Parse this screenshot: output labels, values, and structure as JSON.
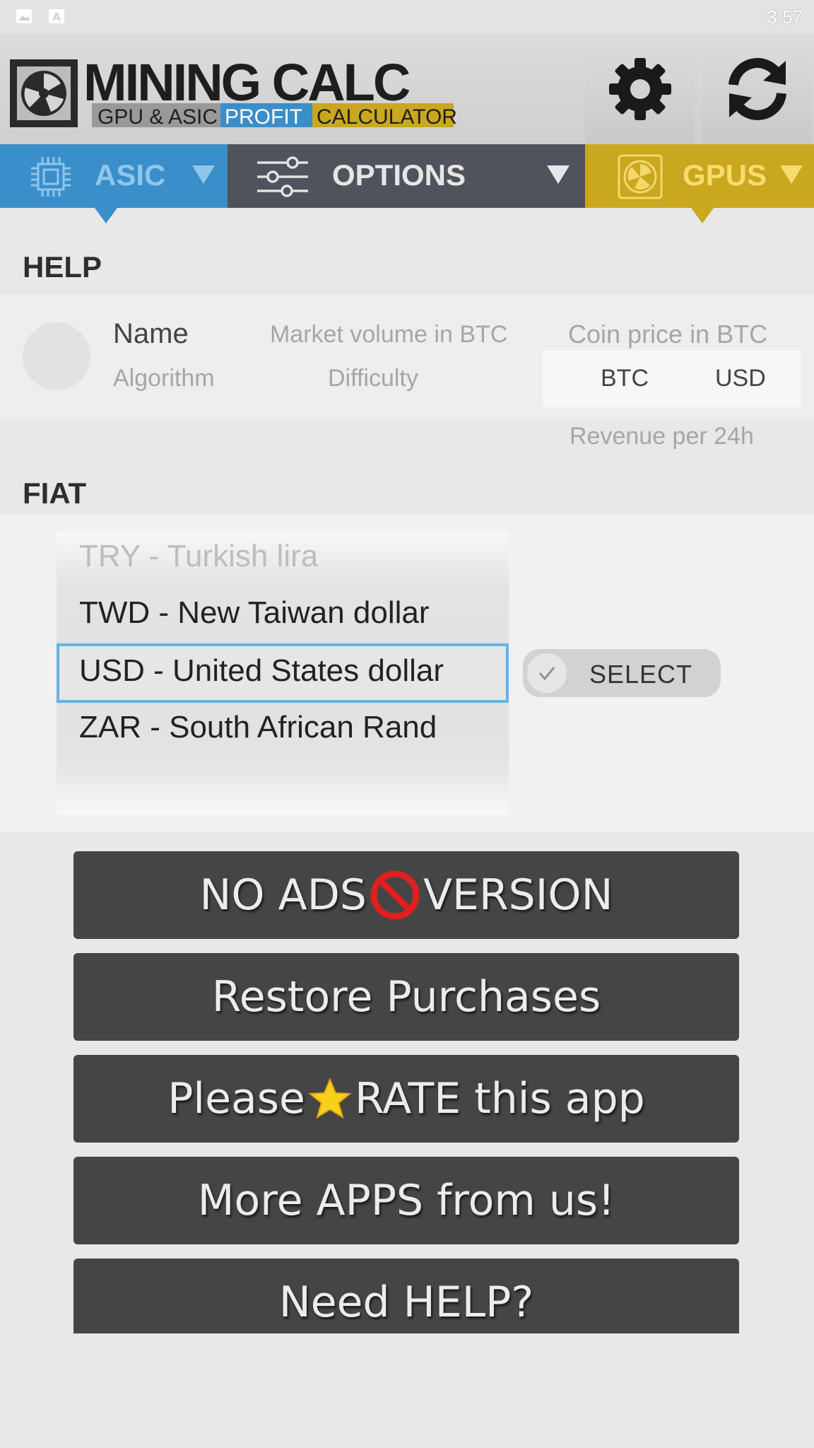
{
  "status_bar": {
    "time": "3:57",
    "icons": [
      "image-icon",
      "font-icon"
    ]
  },
  "header": {
    "logo_title": "MINING CALC",
    "logo_sub1": "GPU & ASIC",
    "logo_sub2": "PROFIT",
    "logo_sub3": "CALCULATOR",
    "settings_icon": "gear-icon",
    "refresh_icon": "refresh-icon"
  },
  "tabs": [
    {
      "label": "ASIC",
      "icon": "chip-icon",
      "color": "#3a8ec9"
    },
    {
      "label": "OPTIONS",
      "icon": "sliders-icon",
      "color": "#50535c"
    },
    {
      "label": "GPUS",
      "icon": "fan-icon",
      "color": "#c9a71e"
    }
  ],
  "help": {
    "title": "HELP",
    "name": "Name",
    "algorithm": "Algorithm",
    "market_volume": "Market volume in BTC",
    "difficulty": "Difficulty",
    "coin_price": "Coin price in BTC",
    "btc": "BTC",
    "usd": "USD",
    "revenue": "Revenue per 24h"
  },
  "fiat": {
    "title": "FIAT",
    "options": [
      "TRY - Turkish lira",
      "TWD - New Taiwan dollar",
      "USD - United States dollar",
      "ZAR - South African Rand"
    ],
    "selected": "USD - United States dollar",
    "select_label": "SELECT"
  },
  "buttons": {
    "no_ads_a": "NO ADS",
    "no_ads_b": "VERSION",
    "restore": "Restore Purchases",
    "rate_a": "Please",
    "rate_b": "RATE this app",
    "more_apps": "More APPS from us!",
    "need_help": "Need HELP?"
  },
  "colors": {
    "accent_blue": "#3a8ec9",
    "accent_gold": "#c9a71e",
    "button_bg": "#454545"
  }
}
